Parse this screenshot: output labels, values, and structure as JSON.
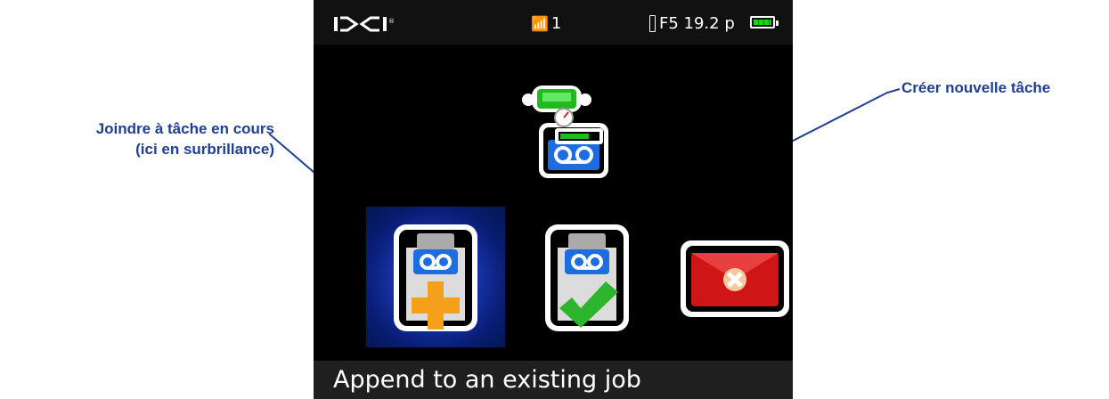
{
  "callouts": {
    "append_line1": "Joindre à tâche en cours",
    "append_line2": "(ici en surbrillance)",
    "create": "Créer nouvelle tâche"
  },
  "status_bar": {
    "brand": "DCI",
    "signal_icon": "antenna-icon",
    "channel": "1",
    "pressure_icon": "pressure-gauge-icon",
    "frequency": "F5 19.2 p",
    "battery_icon": "battery-full-icon"
  },
  "menu": {
    "selected": "append",
    "options": [
      {
        "id": "append",
        "icon": "append-job-icon"
      },
      {
        "id": "create",
        "icon": "create-job-icon"
      },
      {
        "id": "cancel",
        "icon": "cancel-icon"
      }
    ]
  },
  "message": "Append to an existing job",
  "colors": {
    "callout_text": "#1f3f93",
    "highlight": "#1a38b3",
    "screen_bg": "#000000"
  }
}
